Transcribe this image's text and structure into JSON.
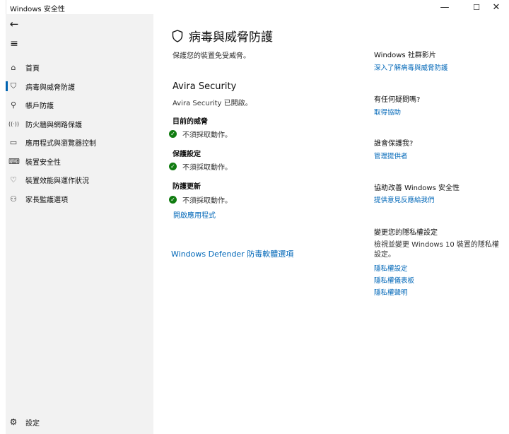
{
  "window": {
    "title": "Windows 安全性",
    "controls": {
      "minimize": "—",
      "maximize": "☐",
      "close": "✕"
    }
  },
  "sidebar": {
    "back_icon": "←",
    "menu_icon": "≡",
    "items": [
      {
        "label": "首頁",
        "icon": "home-icon",
        "glyph": "⌂"
      },
      {
        "label": "病毒與威脅防護",
        "icon": "shield-icon",
        "glyph": "⛉"
      },
      {
        "label": "帳戶防護",
        "icon": "person-icon",
        "glyph": "⚲"
      },
      {
        "label": "防火牆與網路保護",
        "icon": "wireless-icon",
        "glyph": "((·))"
      },
      {
        "label": "應用程式與瀏覽器控制",
        "icon": "browser-icon",
        "glyph": "▭"
      },
      {
        "label": "裝置安全性",
        "icon": "laptop-icon",
        "glyph": "⌨"
      },
      {
        "label": "裝置效能與運作狀況",
        "icon": "heart-icon",
        "glyph": "♡"
      },
      {
        "label": "家長監護選項",
        "icon": "family-icon",
        "glyph": "⚇"
      }
    ],
    "settings": {
      "label": "設定",
      "glyph": "⚙"
    }
  },
  "main": {
    "title": "病毒與威脅防護",
    "subtitle": "保護您的裝置免受威脅。",
    "vendor": "Avira Security",
    "vendor_status": "Avira Security 已開啟。",
    "sections": [
      {
        "heading": "目前的威脅",
        "status": "不須採取動作。"
      },
      {
        "heading": "保護設定",
        "status": "不須採取動作。"
      },
      {
        "heading": "防護更新",
        "status": "不須採取動作。"
      }
    ],
    "open_app_link": "開啟應用程式",
    "defender_link": "Windows Defender 防毒軟體選項"
  },
  "right": {
    "community": {
      "heading": "Windows 社群影片",
      "link": "深入了解病毒與威脅防護"
    },
    "question": {
      "heading": "有任何疑問嗎?",
      "link": "取得協助"
    },
    "who": {
      "heading": "誰會保護我?",
      "link": "管理提供者"
    },
    "improve": {
      "heading": "協助改善 Windows 安全性",
      "link": "提供意見反應給我們"
    },
    "privacy": {
      "heading": "變更您的隱私權設定",
      "text": "檢視並變更 Windows 10 裝置的隱私權設定。",
      "links": [
        "隱私權設定",
        "隱私權儀表板",
        "隱私權聲明"
      ]
    }
  },
  "colors": {
    "accent": "#0063b1",
    "link": "#0067b8",
    "ok": "#107c10",
    "sidebar_bg": "#f2f2f2"
  }
}
